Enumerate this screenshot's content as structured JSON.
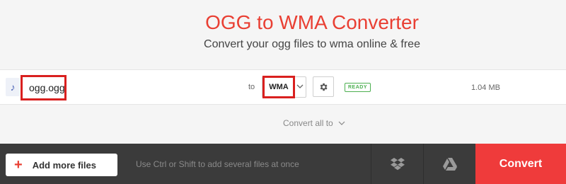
{
  "header": {
    "title": "OGG to WMA Converter",
    "subtitle": "Convert your ogg files to wma online & free"
  },
  "file": {
    "icon": "music-note-icon",
    "name": "ogg.ogg",
    "to_label": "to",
    "format": "WMA",
    "status": "READY",
    "size": "1.04 MB"
  },
  "convert_all": {
    "label": "Convert all to"
  },
  "toolbar": {
    "add_files_label": "Add more files",
    "hint": "Use Ctrl or Shift to add several files at once",
    "convert_label": "Convert"
  },
  "colors": {
    "brand": "#e93f33",
    "convert_bg": "#ef3b3b",
    "highlight_border": "#d9201f",
    "ready": "#4caf50",
    "bottom_bar": "#3b3b3b"
  }
}
